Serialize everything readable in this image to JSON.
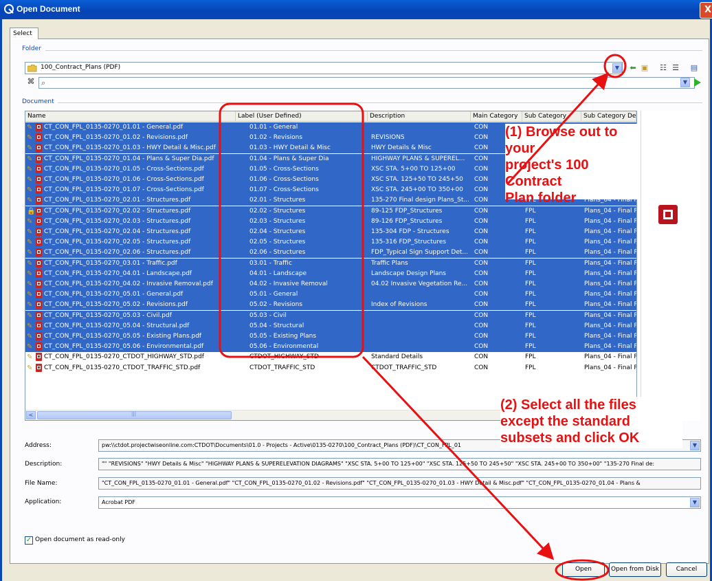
{
  "window": {
    "title": "Open Document",
    "close_label": "X"
  },
  "tabs": [
    {
      "label": "Select"
    }
  ],
  "folder": {
    "group_label": "Folder",
    "path": "100_Contract_Plans (PDF)",
    "search_value": ""
  },
  "document": {
    "group_label": "Document",
    "columns": [
      "Name",
      "Label (User Defined)",
      "Description",
      "Main Category",
      "Sub Category",
      "Sub Category De"
    ],
    "rows": [
      {
        "name": "CT_CON_FPL_0135-0270_01.01 - General.pdf",
        "label": "01.01 - General",
        "description": "",
        "main": "CON",
        "sub": "FPL",
        "subdesc": "Plans_04 - Final P",
        "selected": true,
        "lock": false
      },
      {
        "name": "CT_CON_FPL_0135-0270_01.02 - Revisions.pdf",
        "label": "01.02 - Revisions",
        "description": "REVISIONS",
        "main": "CON",
        "sub": "FPL",
        "subdesc": "Plans_04 - Final P",
        "selected": true,
        "lock": false
      },
      {
        "name": "CT_CON_FPL_0135-0270_01.03 - HWY Detail & Misc.pdf",
        "label": "01.03 - HWY Detail & Misc",
        "description": "HWY Details & Misc",
        "main": "CON",
        "sub": "FPL",
        "subdesc": "Plans_04 - Final P",
        "selected": true,
        "lock": false
      },
      {
        "name": "CT_CON_FPL_0135-0270_01.04 - Plans & Super Dia.pdf",
        "label": "01.04 - Plans & Super Dia",
        "description": "HIGHWAY PLANS & SUPEREL...",
        "main": "CON",
        "sub": "FPL",
        "subdesc": "Plans_04 - Final P",
        "selected": true,
        "lock": false
      },
      {
        "name": "CT_CON_FPL_0135-0270_01.05 - Cross-Sections.pdf",
        "label": "01.05 - Cross-Sections",
        "description": "XSC STA. 5+00 TO 125+00",
        "main": "CON",
        "sub": "FPL",
        "subdesc": "Plans_04 - Final P",
        "selected": true,
        "lock": false
      },
      {
        "name": "CT_CON_FPL_0135-0270_01.06 - Cross-Sections.pdf",
        "label": "01.06 - Cross-Sections",
        "description": "XSC STA. 125+50 TO 245+50",
        "main": "CON",
        "sub": "FPL",
        "subdesc": "Plans_04 - Final P",
        "selected": true,
        "lock": false
      },
      {
        "name": "CT_CON_FPL_0135-0270_01.07 - Cross-Sections.pdf",
        "label": "01.07 - Cross-Sections",
        "description": "XSC STA. 245+00 TO 350+00",
        "main": "CON",
        "sub": "FPL",
        "subdesc": "Plans_04 - Final P",
        "selected": true,
        "lock": false
      },
      {
        "name": "CT_CON_FPL_0135-0270_02.01 - Structures.pdf",
        "label": "02.01 - Structures",
        "description": "135-270 Final design Plans_St...",
        "main": "CON",
        "sub": "FPL",
        "subdesc": "Plans_04 - Final P",
        "selected": true,
        "lock": false
      },
      {
        "name": "CT_CON_FPL_0135-0270_02.02 - Structures.pdf",
        "label": "02.02 - Structures",
        "description": "89-125 FDP_Structures",
        "main": "CON",
        "sub": "FPL",
        "subdesc": "Plans_04 - Final P",
        "selected": true,
        "lock": true
      },
      {
        "name": "CT_CON_FPL_0135-0270_02.03 - Structures.pdf",
        "label": "02.03 - Structures",
        "description": "89-126 FDP_Structures",
        "main": "CON",
        "sub": "FPL",
        "subdesc": "Plans_04 - Final P",
        "selected": true,
        "lock": false
      },
      {
        "name": "CT_CON_FPL_0135-0270_02.04 - Structures.pdf",
        "label": "02.04 - Structures",
        "description": "135-304 FDP - Structures",
        "main": "CON",
        "sub": "FPL",
        "subdesc": "Plans_04 - Final P",
        "selected": true,
        "lock": false
      },
      {
        "name": "CT_CON_FPL_0135-0270_02.05 - Structures.pdf",
        "label": "02.05 - Structures",
        "description": "135-316 FDP_Structures",
        "main": "CON",
        "sub": "FPL",
        "subdesc": "Plans_04 - Final P",
        "selected": true,
        "lock": false
      },
      {
        "name": "CT_CON_FPL_0135-0270_02.06 - Structures.pdf",
        "label": "02.06 - Structures",
        "description": "FDP_Typical Sign Support Det...",
        "main": "CON",
        "sub": "FPL",
        "subdesc": "Plans_04 - Final P",
        "selected": true,
        "lock": false
      },
      {
        "name": "CT_CON_FPL_0135-0270_03.01 - Traffic.pdf",
        "label": "03.01 - Traffic",
        "description": "Traffic Plans",
        "main": "CON",
        "sub": "FPL",
        "subdesc": "Plans_04 - Final P",
        "selected": true,
        "lock": false
      },
      {
        "name": "CT_CON_FPL_0135-0270_04.01 - Landscape.pdf",
        "label": "04.01 - Landscape",
        "description": "Landscape Design Plans",
        "main": "CON",
        "sub": "FPL",
        "subdesc": "Plans_04 - Final P",
        "selected": true,
        "lock": false
      },
      {
        "name": "CT_CON_FPL_0135-0270_04.02 - Invasive Removal.pdf",
        "label": "04.02 - Invasive Removal",
        "description": "04.02 Invasive Vegetation Re...",
        "main": "CON",
        "sub": "FPL",
        "subdesc": "Plans_04 - Final P",
        "selected": true,
        "lock": false
      },
      {
        "name": "CT_CON_FPL_0135-0270_05.01 - General.pdf",
        "label": "05.01 - General",
        "description": "",
        "main": "CON",
        "sub": "FPL",
        "subdesc": "Plans_04 - Final P",
        "selected": true,
        "lock": false
      },
      {
        "name": "CT_CON_FPL_0135-0270_05.02 - Revisions.pdf",
        "label": "05.02 - Revisions",
        "description": "Index of Revisions",
        "main": "CON",
        "sub": "FPL",
        "subdesc": "Plans_04 - Final P",
        "selected": true,
        "lock": false
      },
      {
        "name": "CT_CON_FPL_0135-0270_05.03 - Civil.pdf",
        "label": "05.03 - Civil",
        "description": "",
        "main": "CON",
        "sub": "FPL",
        "subdesc": "Plans_04 - Final P",
        "selected": true,
        "lock": false
      },
      {
        "name": "CT_CON_FPL_0135-0270_05.04 - Structural.pdf",
        "label": "05.04 - Structural",
        "description": "",
        "main": "CON",
        "sub": "FPL",
        "subdesc": "Plans_04 - Final P",
        "selected": true,
        "lock": false
      },
      {
        "name": "CT_CON_FPL_0135-0270_05.05 - Existing Plans.pdf",
        "label": "05.05 - Existing Plans",
        "description": "",
        "main": "CON",
        "sub": "FPL",
        "subdesc": "Plans_04 - Final P",
        "selected": true,
        "lock": false
      },
      {
        "name": "CT_CON_FPL_0135-0270_05.06 - Environmental.pdf",
        "label": "05.06 - Environmental",
        "description": "",
        "main": "CON",
        "sub": "FPL",
        "subdesc": "Plans_04 - Final P",
        "selected": true,
        "lock": false
      },
      {
        "name": "CT_CON_FPL_0135-0270_CTDOT_HIGHWAY_STD.pdf",
        "label": "CTDOT_HIGHWAY_STD",
        "description": "Standard Details",
        "main": "CON",
        "sub": "FPL",
        "subdesc": "Plans_04 - Final P",
        "selected": false,
        "lock": false
      },
      {
        "name": "CT_CON_FPL_0135-0270_CTDOT_TRAFFIC_STD.pdf",
        "label": "CTDOT_TRAFFIC_STD",
        "description": "CTDOT_TRAFFIC_STD",
        "main": "CON",
        "sub": "FPL",
        "subdesc": "Plans_04 - Final P",
        "selected": false,
        "lock": false
      }
    ],
    "scroll_left": "<",
    "scroll_thumb": "|||"
  },
  "fields": {
    "address_label": "Address:",
    "address_value": "pw:\\\\ctdot.projectwiseonline.com:CTDOT\\Documents\\01.0 - Projects - Active\\0135-0270\\100_Contract_Plans (PDF)\\CT_CON_FPL_01",
    "description_label": "Description:",
    "description_value": "\"\" \"REVISIONS\" \"HWY Details & Misc\" \"HIGHWAY PLANS & SUPERELEVATION DIAGRAMS\" \"XSC STA. 5+00 TO 125+00\" \"XSC STA. 125+50 TO 245+50\" \"XSC STA. 245+00 TO 350+00\" \"135-270 Final de:",
    "filename_label": "File Name:",
    "filename_value": "\"CT_CON_FPL_0135-0270_01.01 - General.pdf\" \"CT_CON_FPL_0135-0270_01.02 - Revisions.pdf\" \"CT_CON_FPL_0135-0270_01.03 - HWY Detail & Misc.pdf\" \"CT_CON_FPL_0135-0270_01.04 - Plans &",
    "application_label": "Application:",
    "application_value": "Acrobat PDF"
  },
  "options": {
    "readonly_label": "Open document as read-only",
    "readonly_checked": true
  },
  "buttons": {
    "open": "Open",
    "open_from_disk": "Open from Disk",
    "cancel": "Cancel"
  },
  "annotations": {
    "step1": [
      "(1) Browse out to your",
      "project's 100 Contract",
      "Plan folder"
    ],
    "step2": [
      "(2) Select all the files",
      "except the standard",
      "subsets and click OK"
    ]
  },
  "colors": {
    "selection": "#3168c8",
    "annotation": "#e81010",
    "titlebar": "#0a5fd6"
  },
  "icons": [
    "app-logo-icon",
    "close-icon",
    "folder-icon",
    "binoculars-icon",
    "search-icon",
    "go-arrow-icon",
    "pencil-icon",
    "pdf-icon",
    "lock-icon",
    "list-view-icon",
    "details-view-icon"
  ]
}
